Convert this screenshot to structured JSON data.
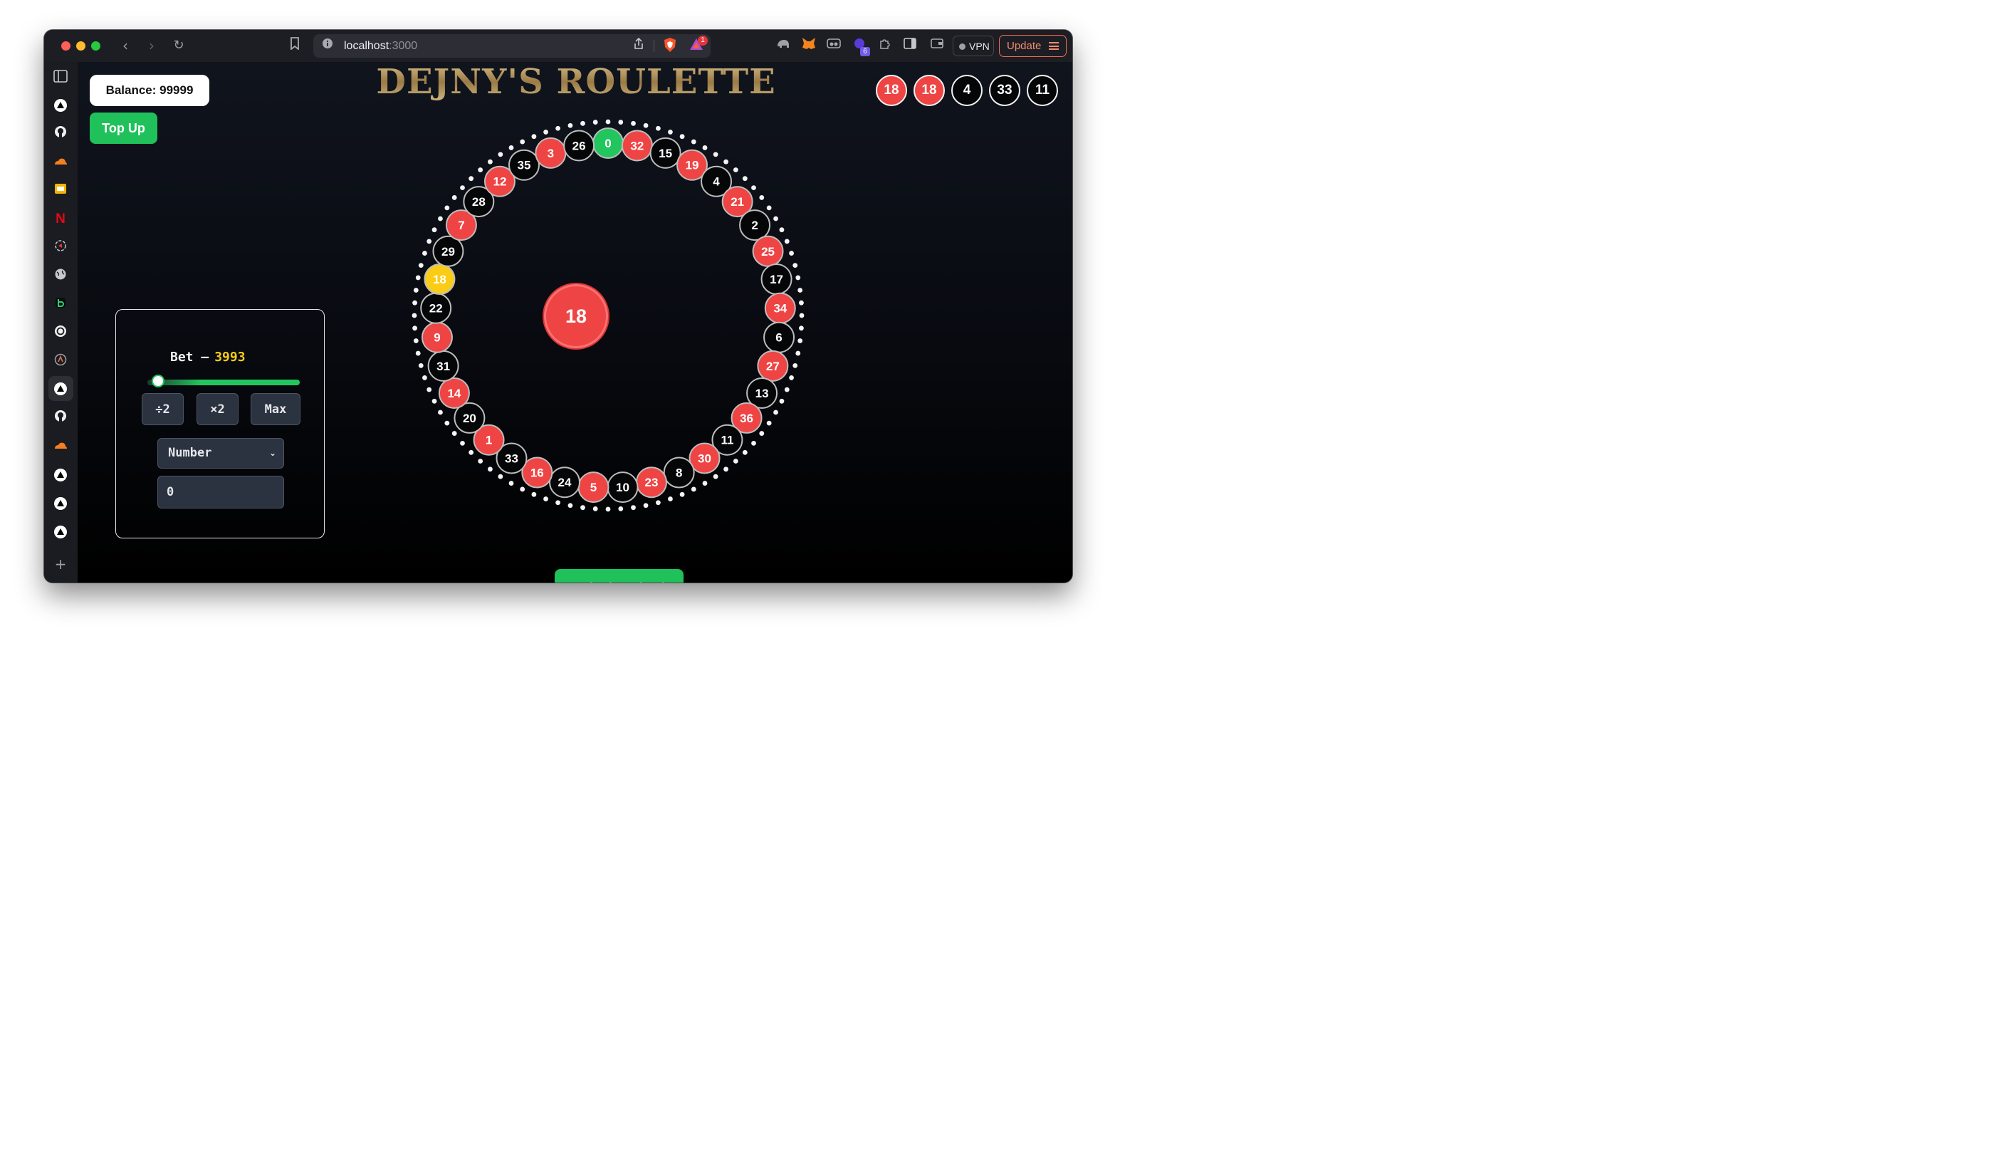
{
  "browser": {
    "url_host": "localhost",
    "url_port": ":3000",
    "vpn_label": "VPN",
    "update_label": "Update",
    "brave_badge": "1",
    "extension_badge": "6"
  },
  "app": {
    "title": "DEJNY'S ROULETTE",
    "balance_label": "Balance: 99999",
    "topup_label": "Top Up",
    "spin_label": "Spin the Wheel",
    "center_result": "18",
    "history": [
      {
        "value": "18",
        "color": "red"
      },
      {
        "value": "18",
        "color": "red"
      },
      {
        "value": "4",
        "color": "black"
      },
      {
        "value": "33",
        "color": "black"
      },
      {
        "value": "11",
        "color": "black"
      }
    ],
    "bet": {
      "label": "Bet –",
      "amount": "3993",
      "slider_fraction": 0.04,
      "half_label": "÷2",
      "double_label": "×2",
      "max_label": "Max",
      "type_selected": "Number",
      "number_value": "0"
    },
    "wheel_numbers": [
      "0",
      "32",
      "15",
      "19",
      "4",
      "21",
      "2",
      "25",
      "17",
      "34",
      "6",
      "27",
      "13",
      "36",
      "11",
      "30",
      "8",
      "23",
      "10",
      "5",
      "24",
      "16",
      "33",
      "1",
      "20",
      "14",
      "31",
      "9",
      "22",
      "18",
      "29",
      "7",
      "28",
      "12",
      "35",
      "3",
      "26"
    ],
    "highlighted_number": "18",
    "colors": {
      "red": "#ef4444",
      "black": "#050608",
      "green": "#22c55e",
      "highlight": "#facc15",
      "accent_green": "#20c15b"
    }
  }
}
